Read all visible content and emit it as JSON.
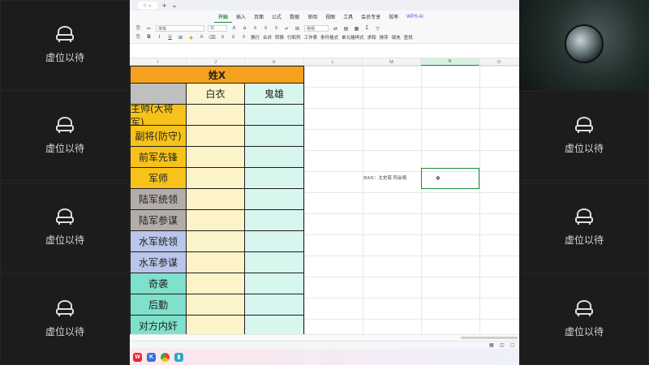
{
  "meeting": {
    "placeholder_label": "虚位以待"
  },
  "app": {
    "titlebar_tab": "⌂ ⌄",
    "menus": [
      "开始",
      "插入",
      "页面",
      "公式",
      "数据",
      "审阅",
      "视图",
      "工具",
      "会员专享",
      "效率",
      "WPS AI"
    ],
    "active_menu": "开始",
    "toolbar": {
      "font_name": "宋体",
      "font_size": "11",
      "wrap_label": "换行",
      "merge_label": "合并",
      "format_label": "常规",
      "convert_label": "转换",
      "row_col_label": "行和列",
      "worksheet_label": "工作表",
      "cond_format_label": "条件格式",
      "table_style_label": "表格样式",
      "cell_style_label": "单元格样式",
      "sum_label": "求和",
      "filter_label": "筛选",
      "sort_label": "排序",
      "fill_label": "填充",
      "find_label": "查找"
    },
    "columns": [
      "I",
      "J",
      "K",
      "L",
      "M",
      "N",
      "O"
    ],
    "selected_column": "N",
    "sheet": {
      "title": "姓X",
      "col_headers": [
        "白衣",
        "鬼雄"
      ],
      "roles": [
        {
          "label": "主帅(大将军)",
          "color": "#f7c31a"
        },
        {
          "label": "副将(防守)",
          "color": "#f7c31a"
        },
        {
          "label": "前军先锋",
          "color": "#f7c31a"
        },
        {
          "label": "军师",
          "color": "#f7c31a"
        },
        {
          "label": "陆军统领",
          "color": "#b3acab"
        },
        {
          "label": "陆军参谋",
          "color": "#b3acab"
        },
        {
          "label": "水军统领",
          "color": "#b9c6ea"
        },
        {
          "label": "水军参谋",
          "color": "#b9c6ea"
        },
        {
          "label": "奇袭",
          "color": "#7fe0cb"
        },
        {
          "label": "后勤",
          "color": "#7fe0cb"
        },
        {
          "label": "对方内奸",
          "color": "#7fe0cb"
        }
      ],
      "baiyi_fill": "#fdf3c8",
      "guixiong_fill": "#d7f6ee",
      "annotation": "BAN：太史慈  阿会喃"
    }
  },
  "colors": {
    "accent_green": "#1a8a3a",
    "title_orange": "#f4a21d"
  }
}
